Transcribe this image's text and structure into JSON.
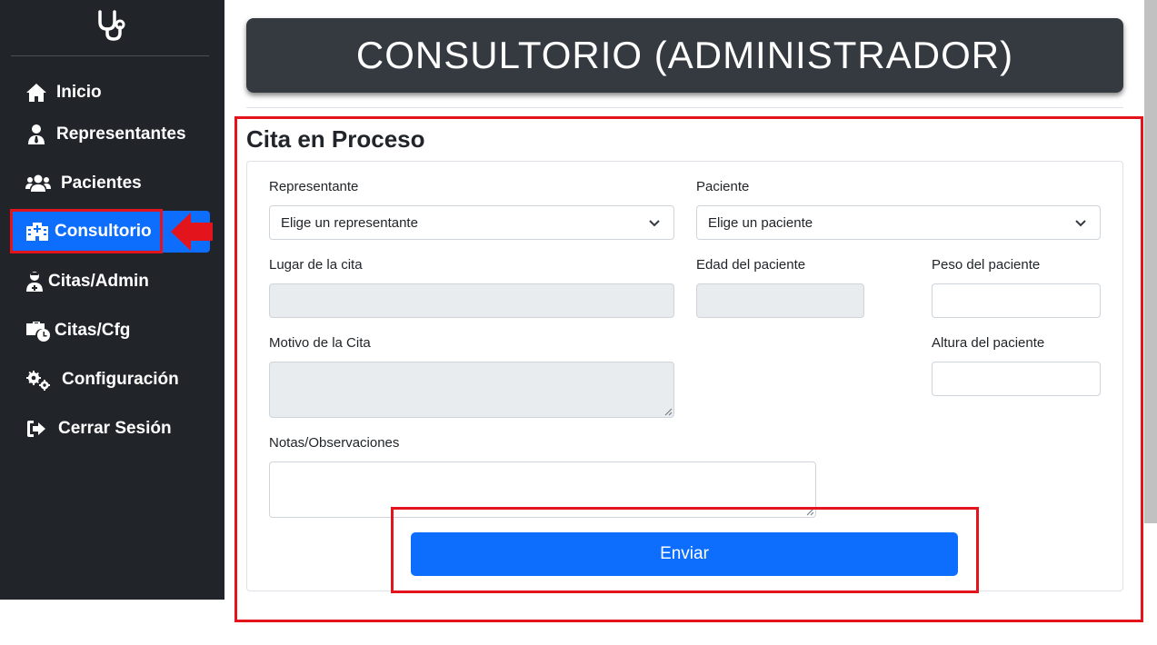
{
  "sidebar": {
    "logo_icon": "stethoscope-icon",
    "items": [
      {
        "label": "Inicio",
        "icon": "home-icon"
      },
      {
        "label": "Representantes",
        "icon": "user-tie-icon"
      },
      {
        "label": "Pacientes",
        "icon": "users-icon"
      },
      {
        "label": "Consultorio",
        "icon": "hospital-icon",
        "active": true
      },
      {
        "label": "Citas/Admin",
        "icon": "user-md-icon"
      },
      {
        "label": "Citas/Cfg",
        "icon": "business-time-icon"
      },
      {
        "label": "Configuración",
        "icon": "cogs-icon"
      },
      {
        "label": "Cerrar Sesión",
        "icon": "sign-out-icon"
      }
    ]
  },
  "header": {
    "title": "CONSULTORIO (ADMINISTRADOR)"
  },
  "form": {
    "title": "Cita en Proceso",
    "representante": {
      "label": "Representante",
      "value": "Elige un representante"
    },
    "paciente": {
      "label": "Paciente",
      "value": "Elige un paciente"
    },
    "lugar": {
      "label": "Lugar de la cita",
      "value": ""
    },
    "edad": {
      "label": "Edad del paciente",
      "value": ""
    },
    "peso": {
      "label": "Peso del paciente",
      "value": ""
    },
    "motivo": {
      "label": "Motivo de la Cita",
      "value": ""
    },
    "altura": {
      "label": "Altura del paciente",
      "value": ""
    },
    "notas": {
      "label": "Notas/Observaciones",
      "value": ""
    },
    "submit_label": "Enviar"
  },
  "colors": {
    "sidebar_bg": "#212529",
    "accent": "#0d6efd",
    "highlight": "#e3141c",
    "banner_bg": "#343a40"
  }
}
